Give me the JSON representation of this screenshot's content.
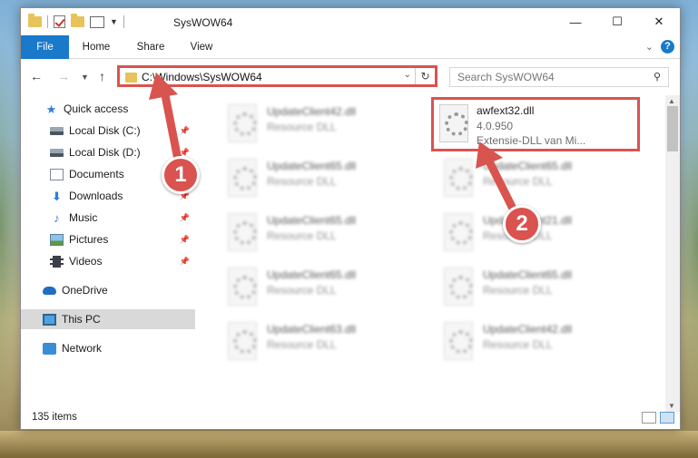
{
  "window": {
    "title": "SysWOW64",
    "controls": {
      "minimize": "—",
      "maximize": "☐",
      "close": "✕"
    }
  },
  "ribbon": {
    "tabs": [
      "File",
      "Home",
      "Share",
      "View"
    ],
    "help": "?"
  },
  "address": {
    "path": "C:\\Windows\\SysWOW64",
    "search_placeholder": "Search SysWOW64"
  },
  "sidebar": {
    "items": [
      {
        "label": "Quick access",
        "icon": "star-icon"
      },
      {
        "label": "Local Disk (C:)",
        "icon": "disk-icon",
        "pinned": true
      },
      {
        "label": "Local Disk (D:)",
        "icon": "disk-icon",
        "pinned": true
      },
      {
        "label": "Documents",
        "icon": "documents-icon",
        "pinned": true
      },
      {
        "label": "Downloads",
        "icon": "download-icon",
        "pinned": true
      },
      {
        "label": "Music",
        "icon": "music-icon",
        "pinned": true
      },
      {
        "label": "Pictures",
        "icon": "pictures-icon",
        "pinned": true
      },
      {
        "label": "Videos",
        "icon": "videos-icon",
        "pinned": true
      },
      {
        "label": "OneDrive",
        "icon": "cloud-icon"
      },
      {
        "label": "This PC",
        "icon": "computer-icon",
        "selected": true
      },
      {
        "label": "Network",
        "icon": "network-icon"
      }
    ]
  },
  "files": {
    "left": [
      {
        "name": "UpdateClient42.dll",
        "type": "Resource DLL"
      },
      {
        "name": "UpdateClient65.dll",
        "type": "Resource DLL"
      },
      {
        "name": "UpdateClient65.dll",
        "type": "Resource DLL"
      },
      {
        "name": "UpdateClient65.dll",
        "type": "Resource DLL"
      },
      {
        "name": "UpdateClient63.dll",
        "type": "Resource DLL"
      }
    ],
    "highlighted": {
      "name": "awfext32.dll",
      "version": "4.0.950",
      "type": "Extensie-DLL van Mi..."
    },
    "right": [
      {
        "name": "UpdateClient65.dll",
        "type": "Resource DLL"
      },
      {
        "name": "UpdateClient21.dll",
        "type": "Resource DLL"
      },
      {
        "name": "UpdateClient65.dll",
        "type": "Resource DLL"
      },
      {
        "name": "UpdateClient42.dll",
        "type": "Resource DLL"
      }
    ]
  },
  "status": {
    "items_count": "135 items"
  },
  "annotations": {
    "callout1": "1",
    "callout2": "2",
    "color": "#d9534f"
  },
  "colors": {
    "accent": "#1979ca",
    "highlight": "#d9534f"
  }
}
